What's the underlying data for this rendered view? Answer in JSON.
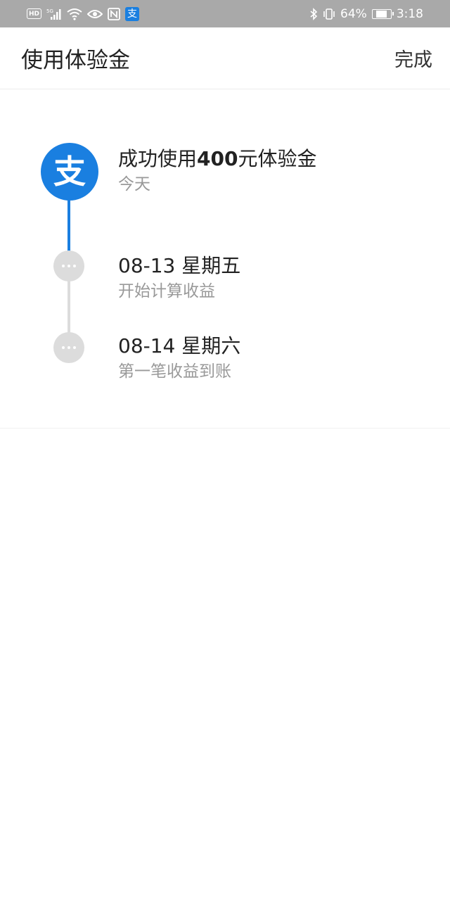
{
  "status_bar": {
    "hd": "HD",
    "network": "5G",
    "battery_percent": "64%",
    "battery_level": 0.64,
    "time": "3:18",
    "alipay_glyph": "支",
    "icons": [
      "hd-icon",
      "signal-5g-icon",
      "wifi-icon",
      "eye-icon",
      "nfc-icon",
      "alipay-icon",
      "bluetooth-icon",
      "vibrate-icon",
      "battery-icon"
    ]
  },
  "nav": {
    "title": "使用体验金",
    "done_label": "完成"
  },
  "timeline": {
    "logo_glyph": "支",
    "items": [
      {
        "title_prefix": "成功使用",
        "amount": "400",
        "title_suffix": "元体验金",
        "subtitle": "今天"
      },
      {
        "title": "08-13 星期五",
        "subtitle": "开始计算收益"
      },
      {
        "title": "08-14 星期六",
        "subtitle": "第一笔收益到账"
      }
    ]
  },
  "colors": {
    "accent": "#1a7fe0",
    "status_bar": "#a9a9a9",
    "inactive": "#dcdcdc",
    "subtitle": "#999999"
  }
}
